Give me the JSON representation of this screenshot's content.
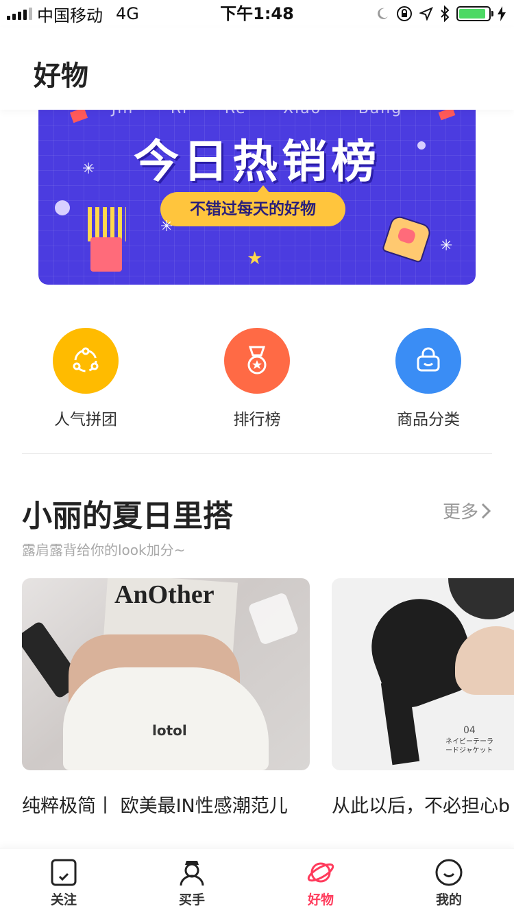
{
  "status_bar": {
    "carrier": "中国移动",
    "network": "4G",
    "time": "下午1:48",
    "battery_level": 0.9
  },
  "header": {
    "title": "好物"
  },
  "banner": {
    "pinyin": [
      "Jin",
      "Ri",
      "Re",
      "Xiao",
      "Bang"
    ],
    "title": "今日热销榜",
    "subtitle": "不错过每天的好物"
  },
  "quick_nav": [
    {
      "label": "人气拼团",
      "color": "#ffbb00",
      "icon": "group-share-icon"
    },
    {
      "label": "排行榜",
      "color": "#ff6a45",
      "icon": "medal-icon"
    },
    {
      "label": "商品分类",
      "color": "#3a8df5",
      "icon": "basket-icon"
    }
  ],
  "section": {
    "title": "小丽的夏日里搭",
    "more": "更多",
    "subtitle": "露肩露背给你的look加分~"
  },
  "cards": [
    {
      "title": "纯粹极简丨 欧美最IN性感潮范儿",
      "image_text": "AnOther",
      "image_note": "lotol"
    },
    {
      "title": "从此以后，不必担心b",
      "image_text": "04",
      "image_note": "ネイビーテーラードジャケット"
    }
  ],
  "tabbar": [
    {
      "label": "关注",
      "icon": "follow-icon",
      "active": false
    },
    {
      "label": "买手",
      "icon": "buyer-icon",
      "active": false
    },
    {
      "label": "好物",
      "icon": "planet-icon",
      "active": true
    },
    {
      "label": "我的",
      "icon": "smile-icon",
      "active": false
    }
  ],
  "colors": {
    "banner_bg": "#4b3ce0",
    "accent": "#ff3b5c",
    "battery": "#4cd964"
  }
}
